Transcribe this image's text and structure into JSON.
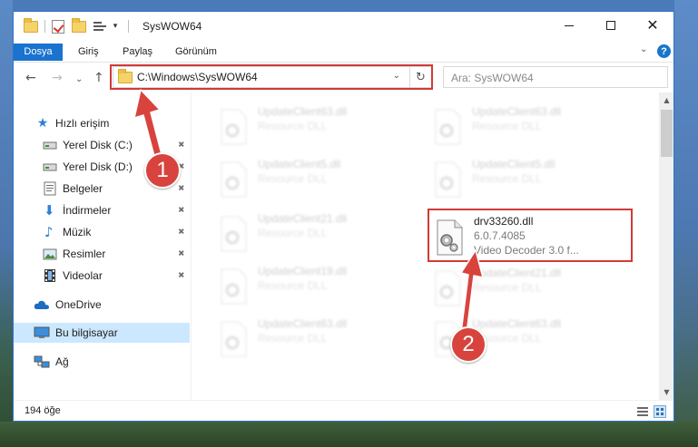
{
  "window": {
    "title": "SysWOW64",
    "minimize_icon": "minimize-icon",
    "maximize_icon": "maximize-icon",
    "close_glyph": "✕"
  },
  "ribbon": {
    "tabs": [
      {
        "label": "Dosya",
        "active": true
      },
      {
        "label": "Giriş",
        "active": false
      },
      {
        "label": "Paylaş",
        "active": false
      },
      {
        "label": "Görünüm",
        "active": false
      }
    ],
    "expand_glyph": "⌄",
    "help_glyph": "?"
  },
  "navigation": {
    "back_glyph": "←",
    "forward_glyph": "→",
    "recent_glyph": "⌄",
    "up_glyph": "↑"
  },
  "address": {
    "path": "C:\\Windows\\SysWOW64",
    "dropdown_glyph": "⌄",
    "refresh_glyph": "↻"
  },
  "search": {
    "placeholder": "Ara: SysWOW64"
  },
  "sidebar": {
    "items": [
      {
        "label": "Hızlı erişim",
        "icon": "star-icon",
        "pinned": false
      },
      {
        "label": "Yerel Disk (C:)",
        "icon": "drive-icon",
        "pinned": true
      },
      {
        "label": "Yerel Disk (D:)",
        "icon": "drive-icon",
        "pinned": true
      },
      {
        "label": "Belgeler",
        "icon": "documents-icon",
        "pinned": true
      },
      {
        "label": "İndirmeler",
        "icon": "download-icon",
        "pinned": true
      },
      {
        "label": "Müzik",
        "icon": "music-icon",
        "pinned": true
      },
      {
        "label": "Resimler",
        "icon": "pictures-icon",
        "pinned": true
      },
      {
        "label": "Videolar",
        "icon": "videos-icon",
        "pinned": true
      },
      {
        "label": "OneDrive",
        "icon": "cloud-icon",
        "pinned": false
      },
      {
        "label": "Bu bilgisayar",
        "icon": "computer-icon",
        "pinned": false,
        "selected": true
      },
      {
        "label": "Ağ",
        "icon": "network-icon",
        "pinned": false
      }
    ],
    "pin_glyph": "📌"
  },
  "files": {
    "left_column": [
      {
        "name": "UpdateClient63.dll",
        "desc": "Resource DLL"
      },
      {
        "name": "UpdateClient5.dll",
        "desc": "Resource DLL"
      },
      {
        "name": "UpdateClient21.dll",
        "desc": "Resource DLL"
      },
      {
        "name": "UpdateClient19.dll",
        "desc": "Resource DLL"
      },
      {
        "name": "UpdateClient63.dll",
        "desc": "Resource DLL"
      }
    ],
    "right_column": [
      {
        "name": "UpdateClient63.dll",
        "desc": "Resource DLL"
      },
      {
        "name": "UpdateClient5.dll",
        "desc": "Resource DLL"
      },
      {
        "name": "UpdateClient21.dll",
        "desc": "Resource DLL"
      },
      {
        "name": "UpdateClient63.dll",
        "desc": "Resource DLL"
      }
    ],
    "highlighted": {
      "name": "drv33260.dll",
      "version": "6.0.7.4085",
      "desc": "Video Decoder 3.0 f..."
    }
  },
  "status": {
    "item_count": "194 öğe"
  },
  "annotations": {
    "step1": "1",
    "step2": "2",
    "accent_color": "#d8433d"
  },
  "colors": {
    "ribbon_active": "#1a73cf",
    "selection": "#cce8ff",
    "highlight_border": "#d13a37"
  }
}
